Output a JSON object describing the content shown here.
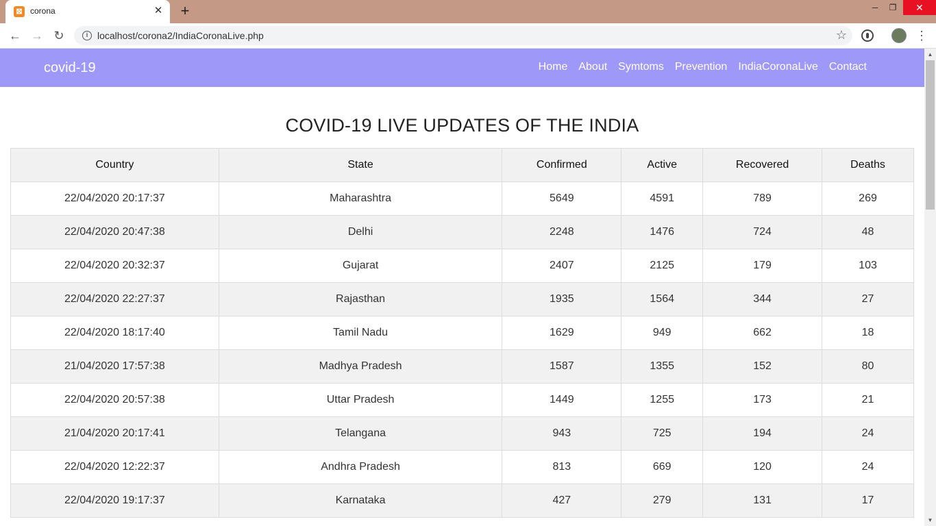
{
  "browser": {
    "tab_title": "corona",
    "url": "localhost/corona2/IndiaCoronaLive.php"
  },
  "site": {
    "brand": "covid-19",
    "nav": [
      "Home",
      "About",
      "Symtoms",
      "Prevention",
      "IndiaCoronaLive",
      "Contact"
    ],
    "heading": "COVID-19 LIVE UPDATES OF THE INDIA"
  },
  "table": {
    "headers": [
      "Country",
      "State",
      "Confirmed",
      "Active",
      "Recovered",
      "Deaths"
    ],
    "rows": [
      [
        "22/04/2020 20:17:37",
        "Maharashtra",
        "5649",
        "4591",
        "789",
        "269"
      ],
      [
        "22/04/2020 20:47:38",
        "Delhi",
        "2248",
        "1476",
        "724",
        "48"
      ],
      [
        "22/04/2020 20:32:37",
        "Gujarat",
        "2407",
        "2125",
        "179",
        "103"
      ],
      [
        "22/04/2020 22:27:37",
        "Rajasthan",
        "1935",
        "1564",
        "344",
        "27"
      ],
      [
        "22/04/2020 18:17:40",
        "Tamil Nadu",
        "1629",
        "949",
        "662",
        "18"
      ],
      [
        "21/04/2020 17:57:38",
        "Madhya Pradesh",
        "1587",
        "1355",
        "152",
        "80"
      ],
      [
        "22/04/2020 20:57:38",
        "Uttar Pradesh",
        "1449",
        "1255",
        "173",
        "21"
      ],
      [
        "21/04/2020 20:17:41",
        "Telangana",
        "943",
        "725",
        "194",
        "24"
      ],
      [
        "22/04/2020 12:22:37",
        "Andhra Pradesh",
        "813",
        "669",
        "120",
        "24"
      ],
      [
        "22/04/2020 19:17:37",
        "Karnataka",
        "427",
        "279",
        "131",
        "17"
      ]
    ]
  }
}
